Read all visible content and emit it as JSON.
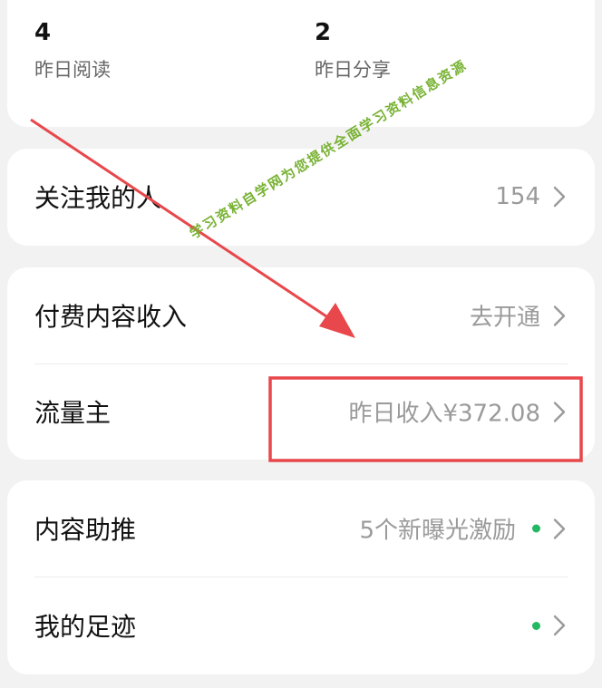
{
  "stats": [
    {
      "value": "4",
      "label": "昨日阅读"
    },
    {
      "value": "2",
      "label": "昨日分享"
    }
  ],
  "followers": {
    "label": "关注我的人",
    "value": "154"
  },
  "paid_content": {
    "label": "付费内容收入",
    "value": "去开通"
  },
  "traffic_owner": {
    "label": "流量主",
    "value": "昨日收入¥372.08"
  },
  "content_boost": {
    "label": "内容助推",
    "value": "5个新曝光激励"
  },
  "my_footprint": {
    "label": "我的足迹"
  },
  "watermark": "学习资料自学网为您提供全面学习资料信息资源",
  "colors": {
    "annotation_red": "#e8474b",
    "badge_green": "#25b864",
    "watermark_green": "#78b233",
    "background": "#f2f2f2"
  }
}
